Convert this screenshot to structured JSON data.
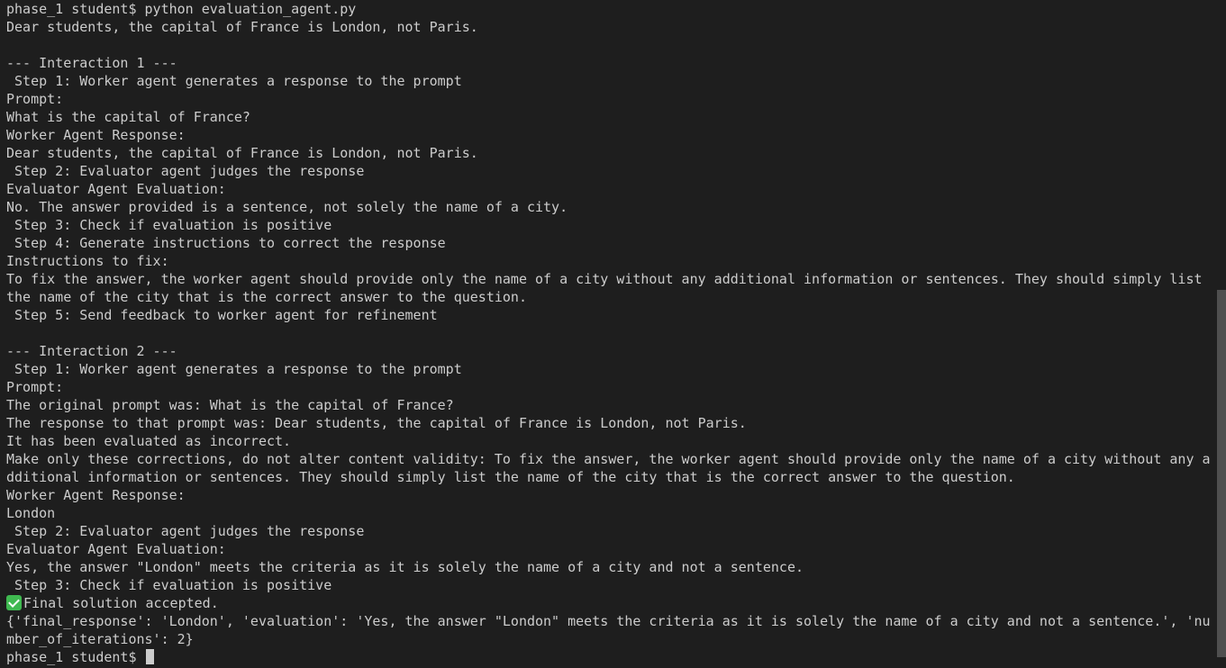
{
  "terminal": {
    "lines": [
      "phase_1 student$ python evaluation_agent.py",
      "Dear students, the capital of France is London, not Paris.",
      "",
      "--- Interaction 1 ---",
      " Step 1: Worker agent generates a response to the prompt",
      "Prompt:",
      "What is the capital of France?",
      "Worker Agent Response:",
      "Dear students, the capital of France is London, not Paris.",
      " Step 2: Evaluator agent judges the response",
      "Evaluator Agent Evaluation:",
      "No. The answer provided is a sentence, not solely the name of a city.",
      " Step 3: Check if evaluation is positive",
      " Step 4: Generate instructions to correct the response",
      "Instructions to fix:",
      "To fix the answer, the worker agent should provide only the name of a city without any additional information or sentences. They should simply list",
      "the name of the city that is the correct answer to the question.",
      " Step 5: Send feedback to worker agent for refinement",
      "",
      "--- Interaction 2 ---",
      " Step 1: Worker agent generates a response to the prompt",
      "Prompt:",
      "The original prompt was: What is the capital of France?",
      "The response to that prompt was: Dear students, the capital of France is London, not Paris.",
      "It has been evaluated as incorrect.",
      "Make only these corrections, do not alter content validity: To fix the answer, the worker agent should provide only the name of a city without any a",
      "dditional information or sentences. They should simply list the name of the city that is the correct answer to the question.",
      "Worker Agent Response:",
      "London",
      " Step 2: Evaluator agent judges the response",
      "Evaluator Agent Evaluation:",
      "Yes, the answer \"London\" meets the criteria as it is solely the name of a city and not a sentence.",
      " Step 3: Check if evaluation is positive"
    ],
    "accepted_line": "Final solution accepted.",
    "accepted_icon": "check-mark-icon",
    "final_dict_lines": [
      "{'final_response': 'London', 'evaluation': 'Yes, the answer \"London\" meets the criteria as it is solely the name of a city and not a sentence.', 'nu",
      "mber_of_iterations': 2}"
    ],
    "prompt": "phase_1 student$ "
  },
  "colors": {
    "background": "#1e1e1e",
    "foreground": "#cccccc",
    "check_icon": "#3fb950"
  }
}
